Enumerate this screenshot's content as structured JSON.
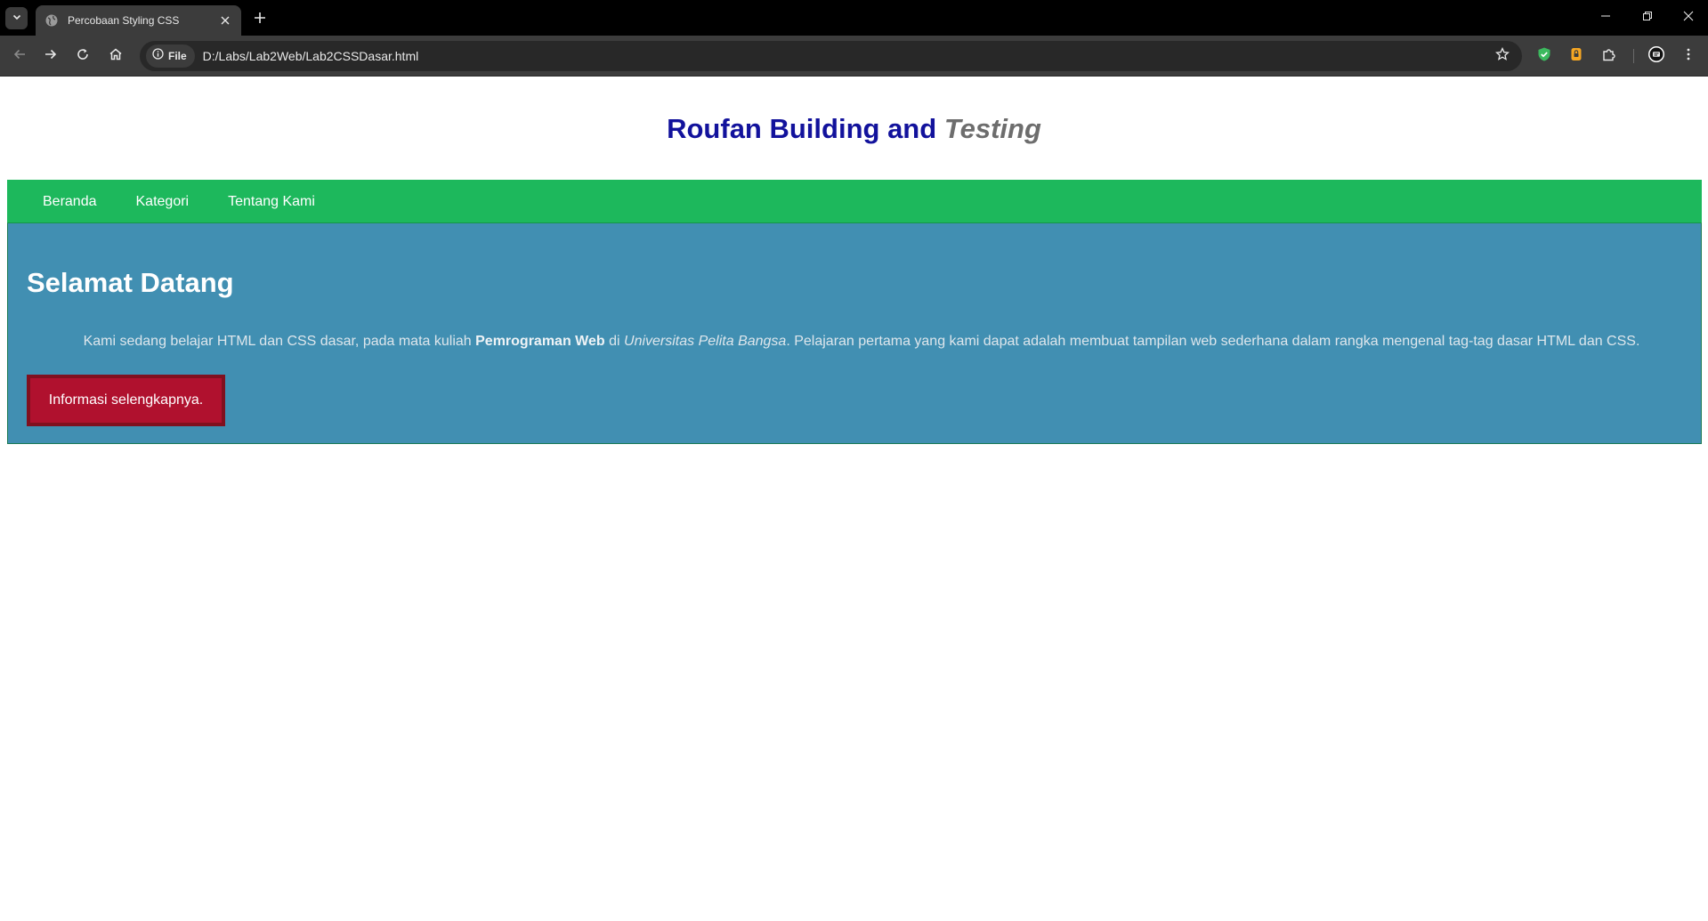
{
  "browser": {
    "tab_title": "Percobaan Styling CSS",
    "site_chip_label": "File",
    "url": "D:/Labs/Lab2Web/Lab2CSSDasar.html",
    "icons": {
      "tab_list": "chevron-down-icon",
      "favicon": "globe-icon",
      "tab_close": "close-icon",
      "new_tab": "plus-icon",
      "back": "arrow-left-icon",
      "forward": "arrow-right-icon",
      "reload": "reload-icon",
      "home": "home-icon",
      "info": "info-icon",
      "bookmark": "star-icon",
      "extensions": "puzzle-icon",
      "menu": "more-vertical-icon"
    }
  },
  "page": {
    "header": {
      "title_plain": "Roufan Building and",
      "title_em": "Testing"
    },
    "nav": {
      "items": [
        {
          "label": "Beranda"
        },
        {
          "label": "Kategori"
        },
        {
          "label": "Tentang Kami"
        }
      ]
    },
    "hero": {
      "title": "Selamat Datang",
      "text_1": "Kami sedang belajar HTML dan CSS dasar, pada mata kuliah",
      "text_bold": "Pemrograman Web",
      "text_2": "di",
      "text_italic": "Universitas Pelita Bangsa",
      "text_3": ". Pelajaran pertama yang kami dapat adalah membuat tampilan web sederhana dalam rangka mengenal tag-tag dasar HTML dan CSS.",
      "button_label": "Informasi selengkapnya."
    }
  },
  "colors": {
    "header_title": "#12129c",
    "header_em": "#6d6d6d",
    "nav_bg": "#1db85c",
    "hero_bg": "#418fb2",
    "button_bg": "#b0112e",
    "button_border": "#80101f"
  }
}
